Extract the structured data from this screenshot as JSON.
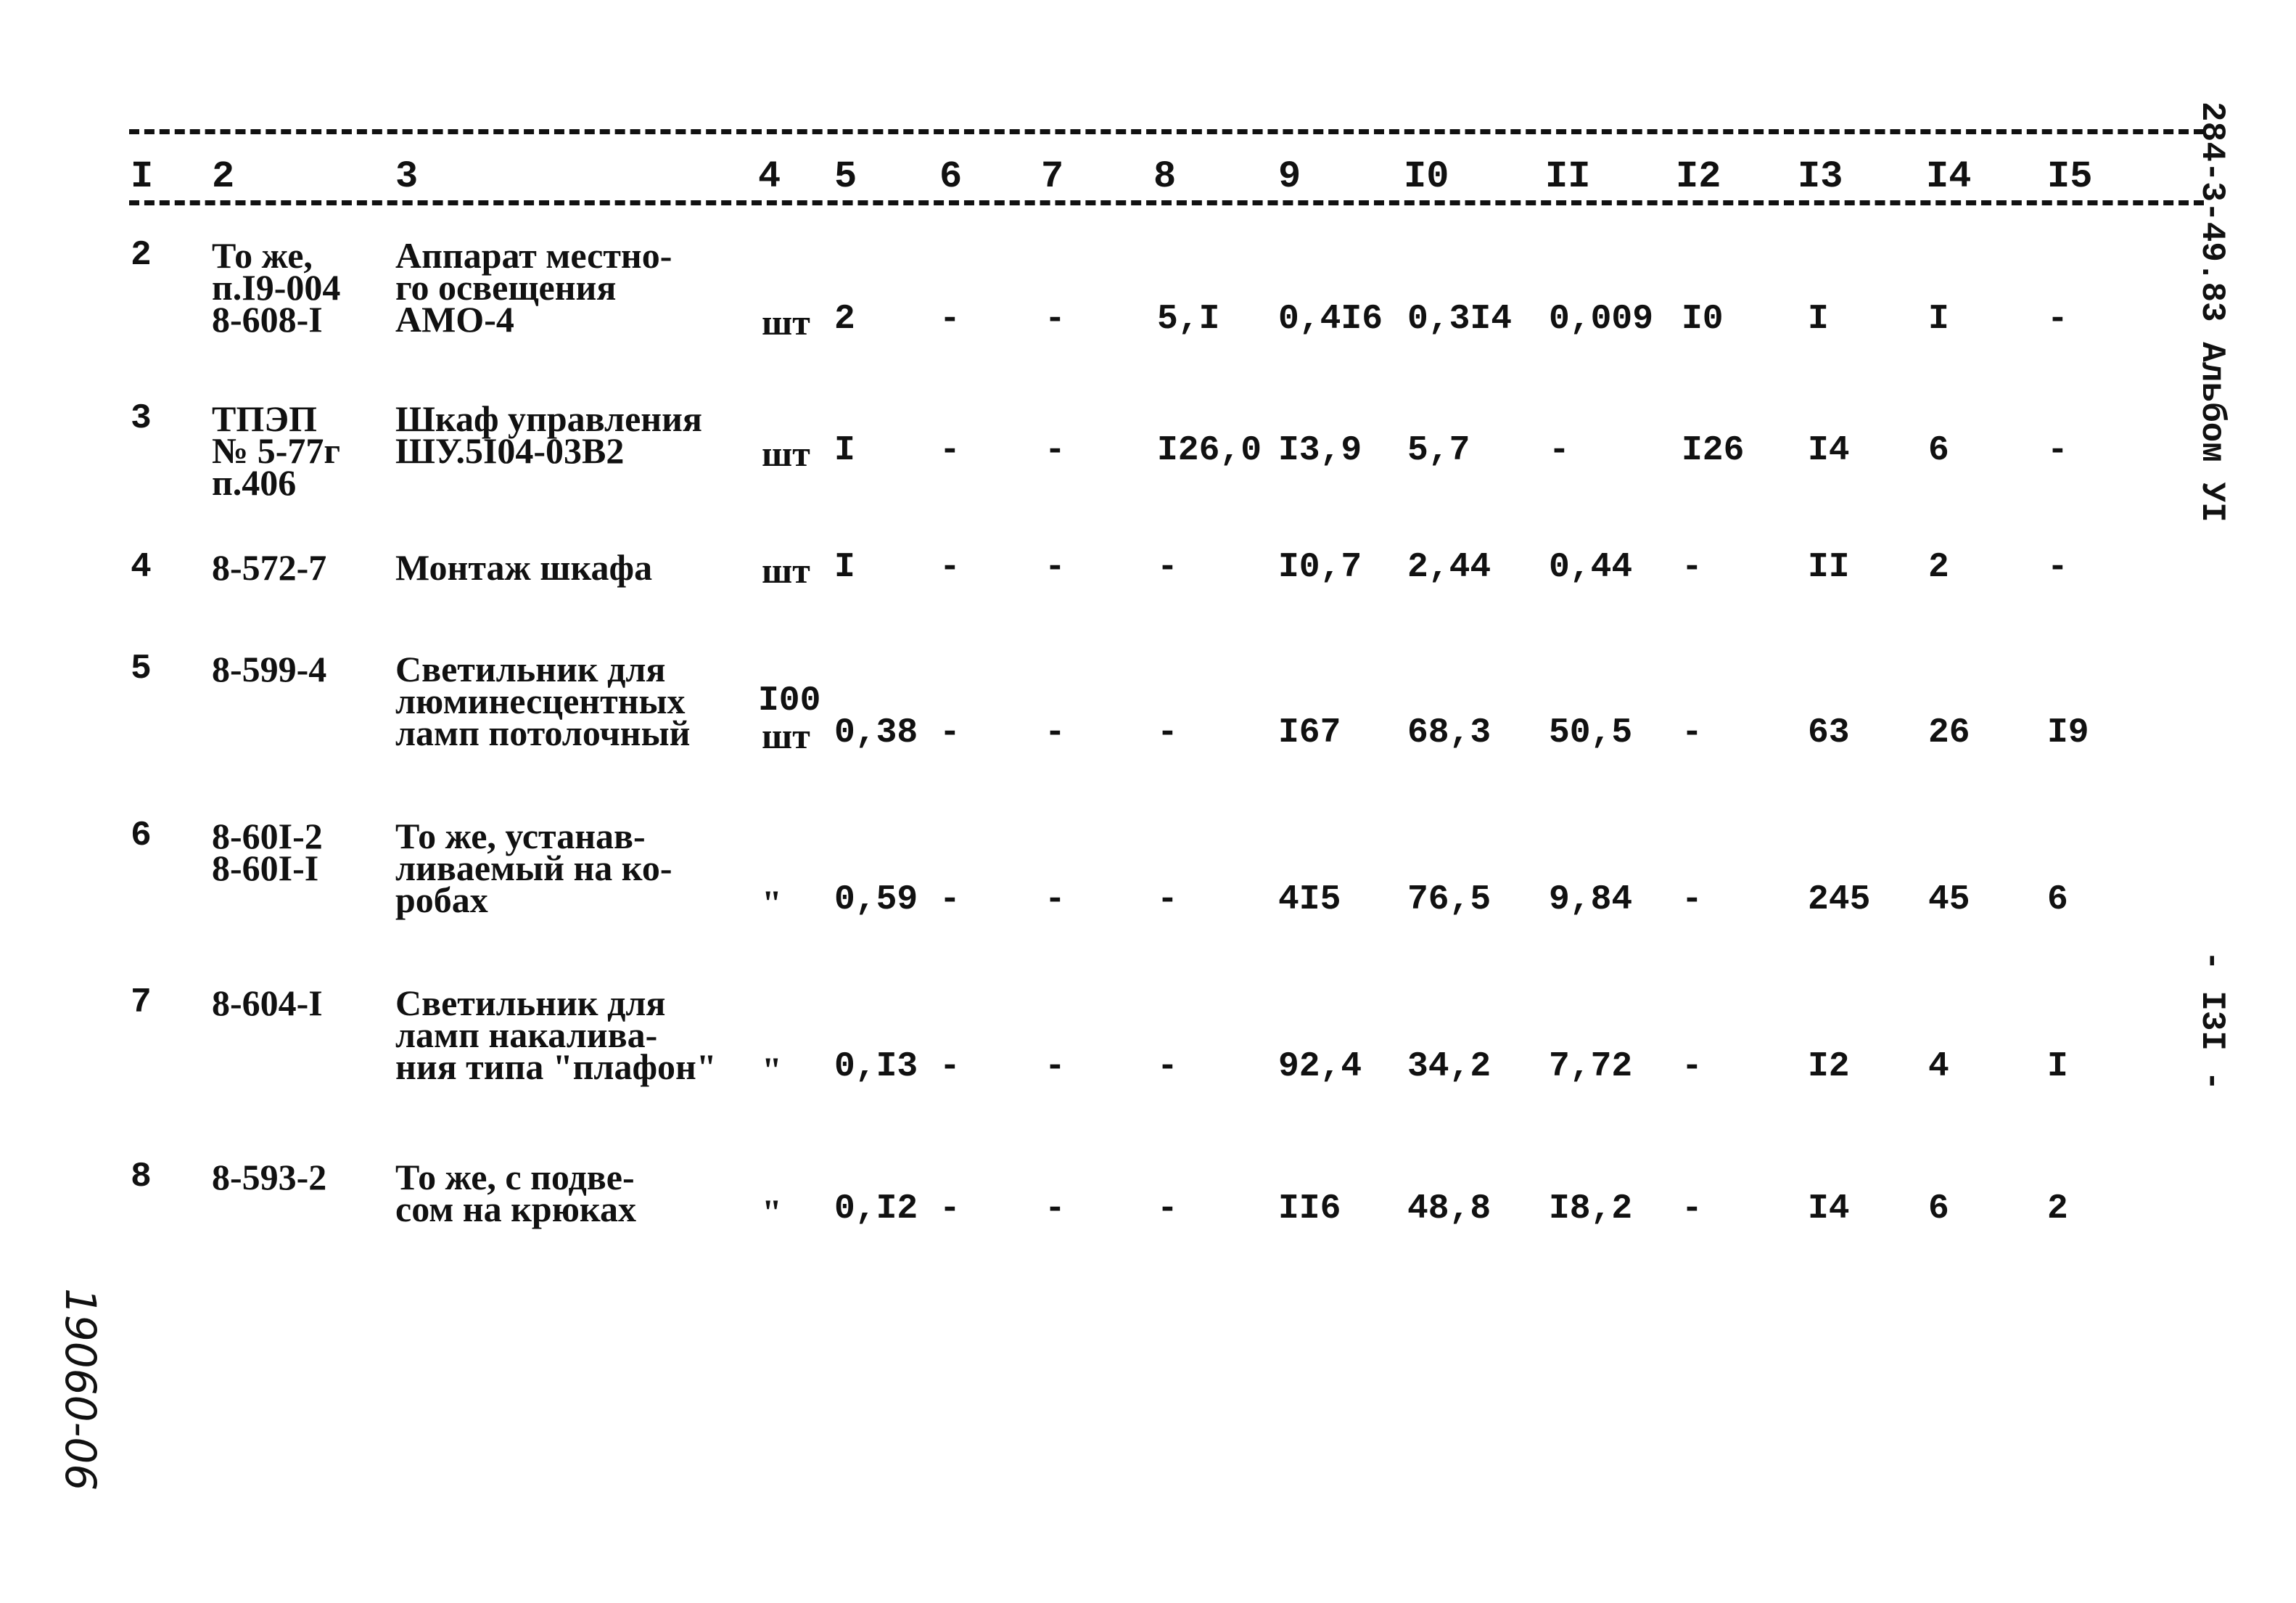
{
  "document": {
    "side_label": "284-3-49.83 Альбом УI",
    "page_number": "- I3I -",
    "archive_number": "19060-06"
  },
  "table": {
    "column_numbers": [
      "I",
      "2",
      "3",
      "4",
      "5",
      "6",
      "7",
      "8",
      "9",
      "I0",
      "II",
      "I2",
      "I3",
      "I4",
      "I5"
    ],
    "rows": [
      {
        "no": "2",
        "code": [
          "То же,",
          "п.I9-004",
          "8-608-I"
        ],
        "name": [
          "Аппарат местно-",
          "го освещения",
          "АМО-4"
        ],
        "unit": "шт",
        "c5": "2",
        "c6": "-",
        "c7": "-",
        "c8": "5,I",
        "c9": "0,4I6",
        "c10": "0,3I4",
        "c11": "0,009",
        "c12": "I0",
        "c13": "I",
        "c14": "I",
        "c15": "-"
      },
      {
        "no": "3",
        "code": [
          "ТПЭП",
          "№ 5-77г",
          "п.406"
        ],
        "name": [
          "Шкаф управления",
          "ШУ.5I04-03В2"
        ],
        "unit": "шт",
        "c5": "I",
        "c6": "-",
        "c7": "-",
        "c8": "I26,0",
        "c9": "I3,9",
        "c10": "5,7",
        "c11": "-",
        "c12": "I26",
        "c13": "I4",
        "c14": "6",
        "c15": "-"
      },
      {
        "no": "4",
        "code": [
          "8-572-7"
        ],
        "name": [
          "Монтаж шкафа"
        ],
        "unit": "шт",
        "c5": "I",
        "c6": "-",
        "c7": "-",
        "c8": "-",
        "c9": "I0,7",
        "c10": "2,44",
        "c11": "0,44",
        "c12": "-",
        "c13": "II",
        "c14": "2",
        "c15": "-"
      },
      {
        "no": "5",
        "code": [
          "8-599-4"
        ],
        "name": [
          "Светильник для",
          "люминесцентных",
          "ламп потолочный"
        ],
        "unit_top": "I00",
        "unit": "шт",
        "c5": "0,38",
        "c6": "-",
        "c7": "-",
        "c8": "-",
        "c9": "I67",
        "c10": "68,3",
        "c11": "50,5",
        "c12": "-",
        "c13": "63",
        "c14": "26",
        "c15": "I9"
      },
      {
        "no": "6",
        "code": [
          "8-60I-2",
          "8-60I-I"
        ],
        "name": [
          "То же, устанав-",
          "ливаемый на ко-",
          "робах"
        ],
        "unit": "\"",
        "c5": "0,59",
        "c6": "-",
        "c7": "-",
        "c8": "-",
        "c9": "4I5",
        "c10": "76,5",
        "c11": "9,84",
        "c12": "-",
        "c13": "245",
        "c14": "45",
        "c15": "6"
      },
      {
        "no": "7",
        "code": [
          "8-604-I"
        ],
        "name": [
          "Светильник для",
          "ламп накалива-",
          "ния типа \"плафон\""
        ],
        "unit": "\"",
        "c5": "0,I3",
        "c6": "-",
        "c7": "-",
        "c8": "-",
        "c9": "92,4",
        "c10": "34,2",
        "c11": "7,72",
        "c12": "-",
        "c13": "I2",
        "c14": "4",
        "c15": "I"
      },
      {
        "no": "8",
        "code": [
          "8-593-2"
        ],
        "name": [
          "То же, с подве-",
          "сом на крюках"
        ],
        "unit": "\"",
        "c5": "0,I2",
        "c6": "-",
        "c7": "-",
        "c8": "-",
        "c9": "II6",
        "c10": "48,8",
        "c11": "I8,2",
        "c12": "-",
        "c13": "I4",
        "c14": "6",
        "c15": "2"
      }
    ]
  }
}
